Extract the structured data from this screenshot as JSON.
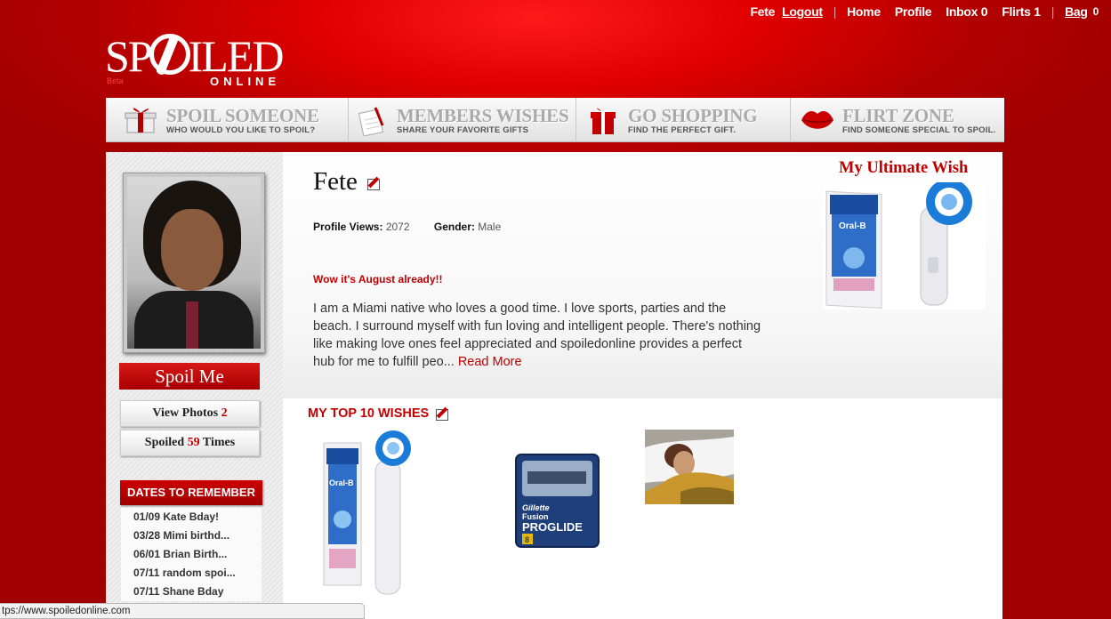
{
  "topnav": {
    "username": "Fete",
    "logout": "Logout",
    "home": "Home",
    "profile": "Profile",
    "inbox": "Inbox 0",
    "flirts": "Flirts 1",
    "bag": "Bag",
    "bag_count": "0"
  },
  "logo": {
    "main_left": "SP",
    "main_right": "ILED",
    "sub": "ONLINE",
    "beta": "Beta"
  },
  "nav": [
    {
      "title": "SPOIL SOMEONE",
      "subtitle": "WHO WOULD YOU LIKE TO SPOIL?",
      "icon": "gift-icon"
    },
    {
      "title": "MEMBERS WISHES",
      "subtitle": "SHARE YOUR FAVORITE GIFTS",
      "icon": "wishlist-icon"
    },
    {
      "title": "GO SHOPPING",
      "subtitle": "FIND THE PERFECT GIFT.",
      "icon": "present-icon"
    },
    {
      "title": "FLIRT ZONE",
      "subtitle": "FIND SOMEONE SPECIAL TO SPOIL.",
      "icon": "lips-icon"
    }
  ],
  "sidebar": {
    "spoil_me": "Spoil Me",
    "view_photos_label": "View Photos",
    "view_photos_count": "2",
    "spoiled_label": "Spoiled",
    "spoiled_count": "59",
    "spoiled_suffix": "Times",
    "dates_title": "DATES TO REMEMBER",
    "dates": [
      "01/09 Kate Bday!",
      "03/28 Mimi birthd...",
      "06/01 Brian Birth...",
      "07/11 random spoi...",
      "07/11 Shane Bday"
    ]
  },
  "profile": {
    "name": "Fete",
    "views_label": "Profile Views:",
    "views": "2072",
    "gender_label": "Gender:",
    "gender": "Male",
    "status": "Wow it's August already!!",
    "about": "I am a Miami native who loves a good time. I love sports, parties and the beach. I surround myself with fun loving and intelligent people. There's nothing like making love ones feel appreciated and spoiledonline provides a perfect hub for me to fulfill peo...",
    "read_more": "Read More"
  },
  "ultimate_wish": {
    "title": "My Ultimate Wish",
    "brand": "Oral-B"
  },
  "top_wishes": {
    "title": "MY TOP 10 WISHES",
    "items": [
      {
        "brand": "Oral-B"
      },
      {
        "brand": "Gillette",
        "line1": "Fusion",
        "line2": "PROGLIDE",
        "count": "8"
      },
      {
        "brand": ""
      }
    ]
  },
  "status_bar": {
    "url": "tps://www.spoiledonline.com"
  },
  "colors": {
    "brand_red": "#c00000",
    "bg_red": "#b30000"
  }
}
